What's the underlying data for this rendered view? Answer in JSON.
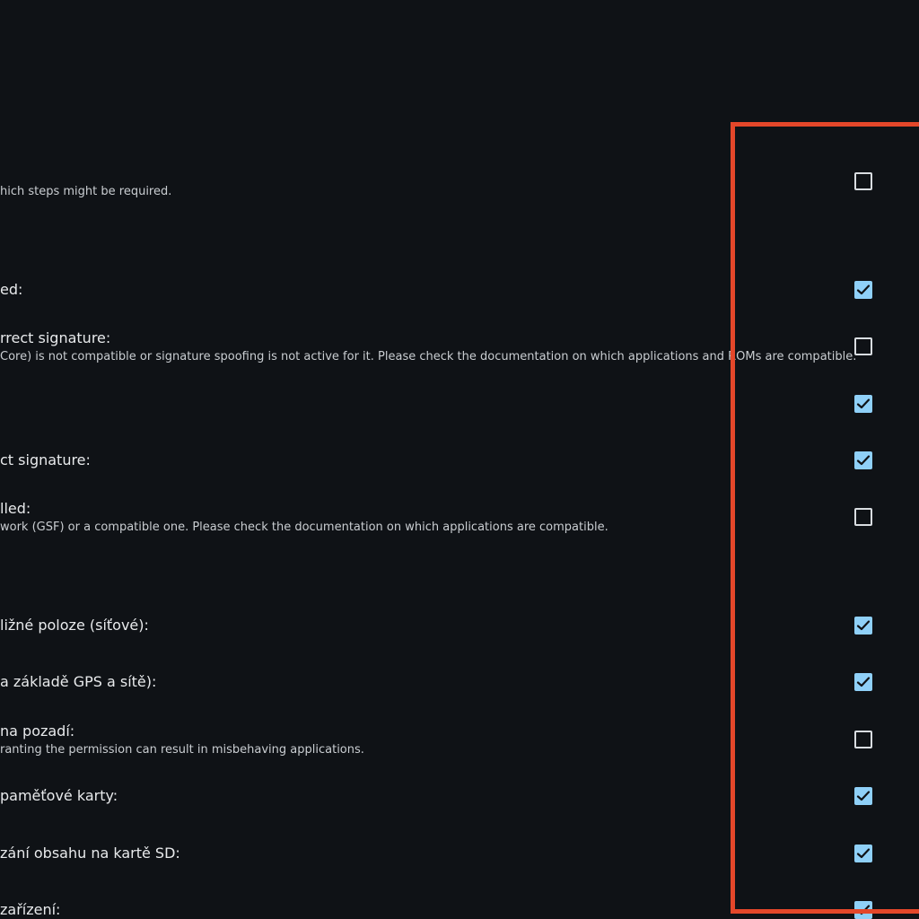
{
  "rows": [
    {
      "title": "",
      "subtitle": "hich steps might be required.",
      "checked": false
    },
    {
      "title": "ed:",
      "subtitle": "",
      "checked": true
    },
    {
      "title": "rrect signature:",
      "subtitle": "Core) is not compatible or signature spoofing is not active for it. Please check the documentation on which applications and ROMs are compatible.",
      "checked": false
    },
    {
      "title": "",
      "subtitle": "",
      "checked": true
    },
    {
      "title": "ct signature:",
      "subtitle": "",
      "checked": true
    },
    {
      "title": "lled:",
      "subtitle": "work (GSF) or a compatible one. Please check the documentation on which applications are compatible.",
      "checked": false
    },
    {
      "title": "ližné poloze (síťové):",
      "subtitle": "",
      "checked": true
    },
    {
      "title": "a základě GPS a sítě):",
      "subtitle": "",
      "checked": true
    },
    {
      "title": "na pozadí:",
      "subtitle": "ranting the permission can result in misbehaving applications.",
      "checked": false
    },
    {
      "title": "paměťové karty:",
      "subtitle": "",
      "checked": true
    },
    {
      "title": "zání obsahu na kartě SD:",
      "subtitle": "",
      "checked": true
    },
    {
      "title": "zařízení:",
      "subtitle": "",
      "checked": true
    }
  ],
  "colors": {
    "background": "#0f1216",
    "checkbox_checked": "#8fd0f8",
    "highlight_border": "#e4472a"
  }
}
